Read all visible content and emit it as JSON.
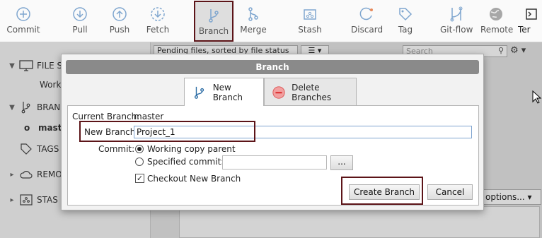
{
  "toolbar": {
    "items": [
      {
        "label": "Commit",
        "icon": "plus-circle-icon"
      },
      {
        "label": "Pull",
        "icon": "arrow-down-circle-icon"
      },
      {
        "label": "Push",
        "icon": "arrow-up-circle-icon"
      },
      {
        "label": "Fetch",
        "icon": "fetch-icon"
      },
      {
        "label": "Branch",
        "icon": "branch-icon"
      },
      {
        "label": "Merge",
        "icon": "merge-icon"
      },
      {
        "label": "Stash",
        "icon": "stash-icon"
      },
      {
        "label": "Discard",
        "icon": "discard-icon"
      },
      {
        "label": "Tag",
        "icon": "tag-icon"
      },
      {
        "label": "Git-flow",
        "icon": "git-flow-icon"
      },
      {
        "label": "Remote",
        "icon": "globe-icon"
      },
      {
        "label": "Ter",
        "icon": "terminal-icon"
      }
    ]
  },
  "sidebar": {
    "file_status": "FILE S",
    "working_copy": "Work",
    "branches": "BRAN",
    "master": "mast",
    "tags": "TAGS",
    "remotes": "REMO",
    "stashes": "STAS"
  },
  "main": {
    "filter_dropdown": "Pending files, sorted by file status",
    "search_placeholder": "Search",
    "options_button": "options..."
  },
  "dialog": {
    "title": "Branch",
    "tabs": {
      "new_branch": "New Branch",
      "delete_branches": "Delete Branches"
    },
    "current_branch_label": "Current Branch:",
    "current_branch_value": "master",
    "new_branch_label": "New Branch:",
    "new_branch_value": "Project_1",
    "commit_label": "Commit:",
    "working_copy_parent": "Working copy parent",
    "specified_commit": "Specified commit:",
    "browse_button": "...",
    "checkout_label": "Checkout New Branch",
    "create_button": "Create Branch",
    "cancel_button": "Cancel"
  },
  "colors": {
    "highlight": "#5c1418",
    "toolbar_icon": "#7fa6cf"
  }
}
